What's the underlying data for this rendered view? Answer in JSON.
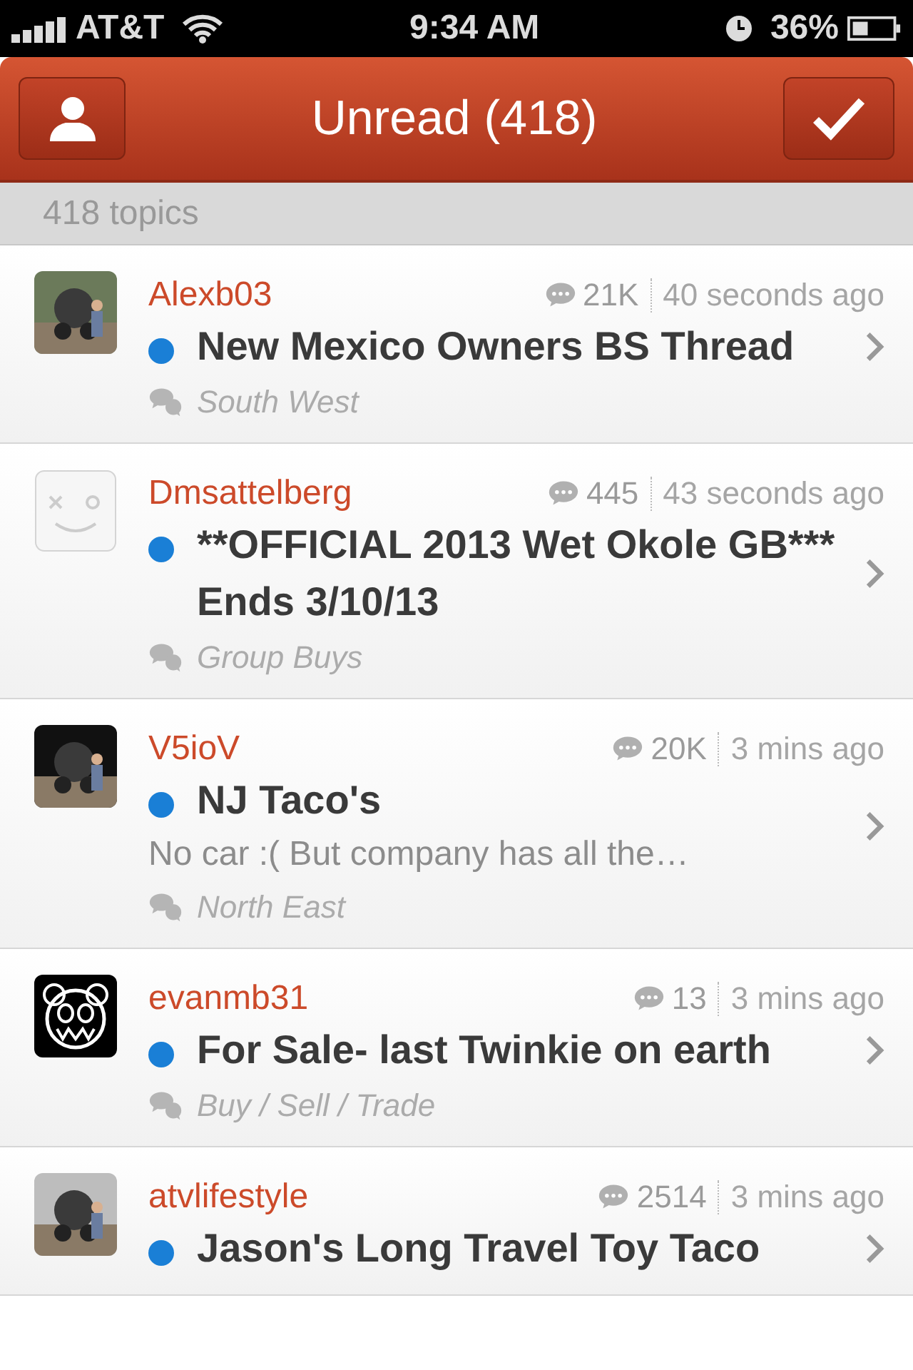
{
  "status_bar": {
    "carrier": "AT&T",
    "time": "9:34 AM",
    "battery": "36%"
  },
  "nav": {
    "title": "Unread (418)"
  },
  "subheader": "418 topics",
  "topics": [
    {
      "user": "Alexb03",
      "replies": "21K",
      "time": "40 seconds ago",
      "unread": true,
      "title": "New Mexico Owners BS Thread",
      "forum": "South West"
    },
    {
      "avatar": {
        "kind": "blank"
      },
      "user": "Dmsattelberg",
      "replies": "445",
      "time": "43 seconds ago",
      "unread": true,
      "title": "**OFFICIAL 2013 Wet Okole GB*** Ends 3/10/13",
      "forum": "Group Buys"
    },
    {
      "user": "V5ioV",
      "replies": "20K",
      "time": "3 mins ago",
      "unread": true,
      "title": "NJ Taco's",
      "preview": "No car :( But company has all the…",
      "forum": "North East"
    },
    {
      "avatar": {
        "kind": "logo"
      },
      "user": "evanmb31",
      "replies": "13",
      "time": "3 mins ago",
      "unread": true,
      "title": "For Sale- last Twinkie on earth",
      "forum": "Buy / Sell / Trade"
    },
    {
      "user": "atvlifestyle",
      "replies": "2514",
      "time": "3 mins ago",
      "unread": true,
      "title": "Jason's Long Travel Toy Taco"
    }
  ]
}
